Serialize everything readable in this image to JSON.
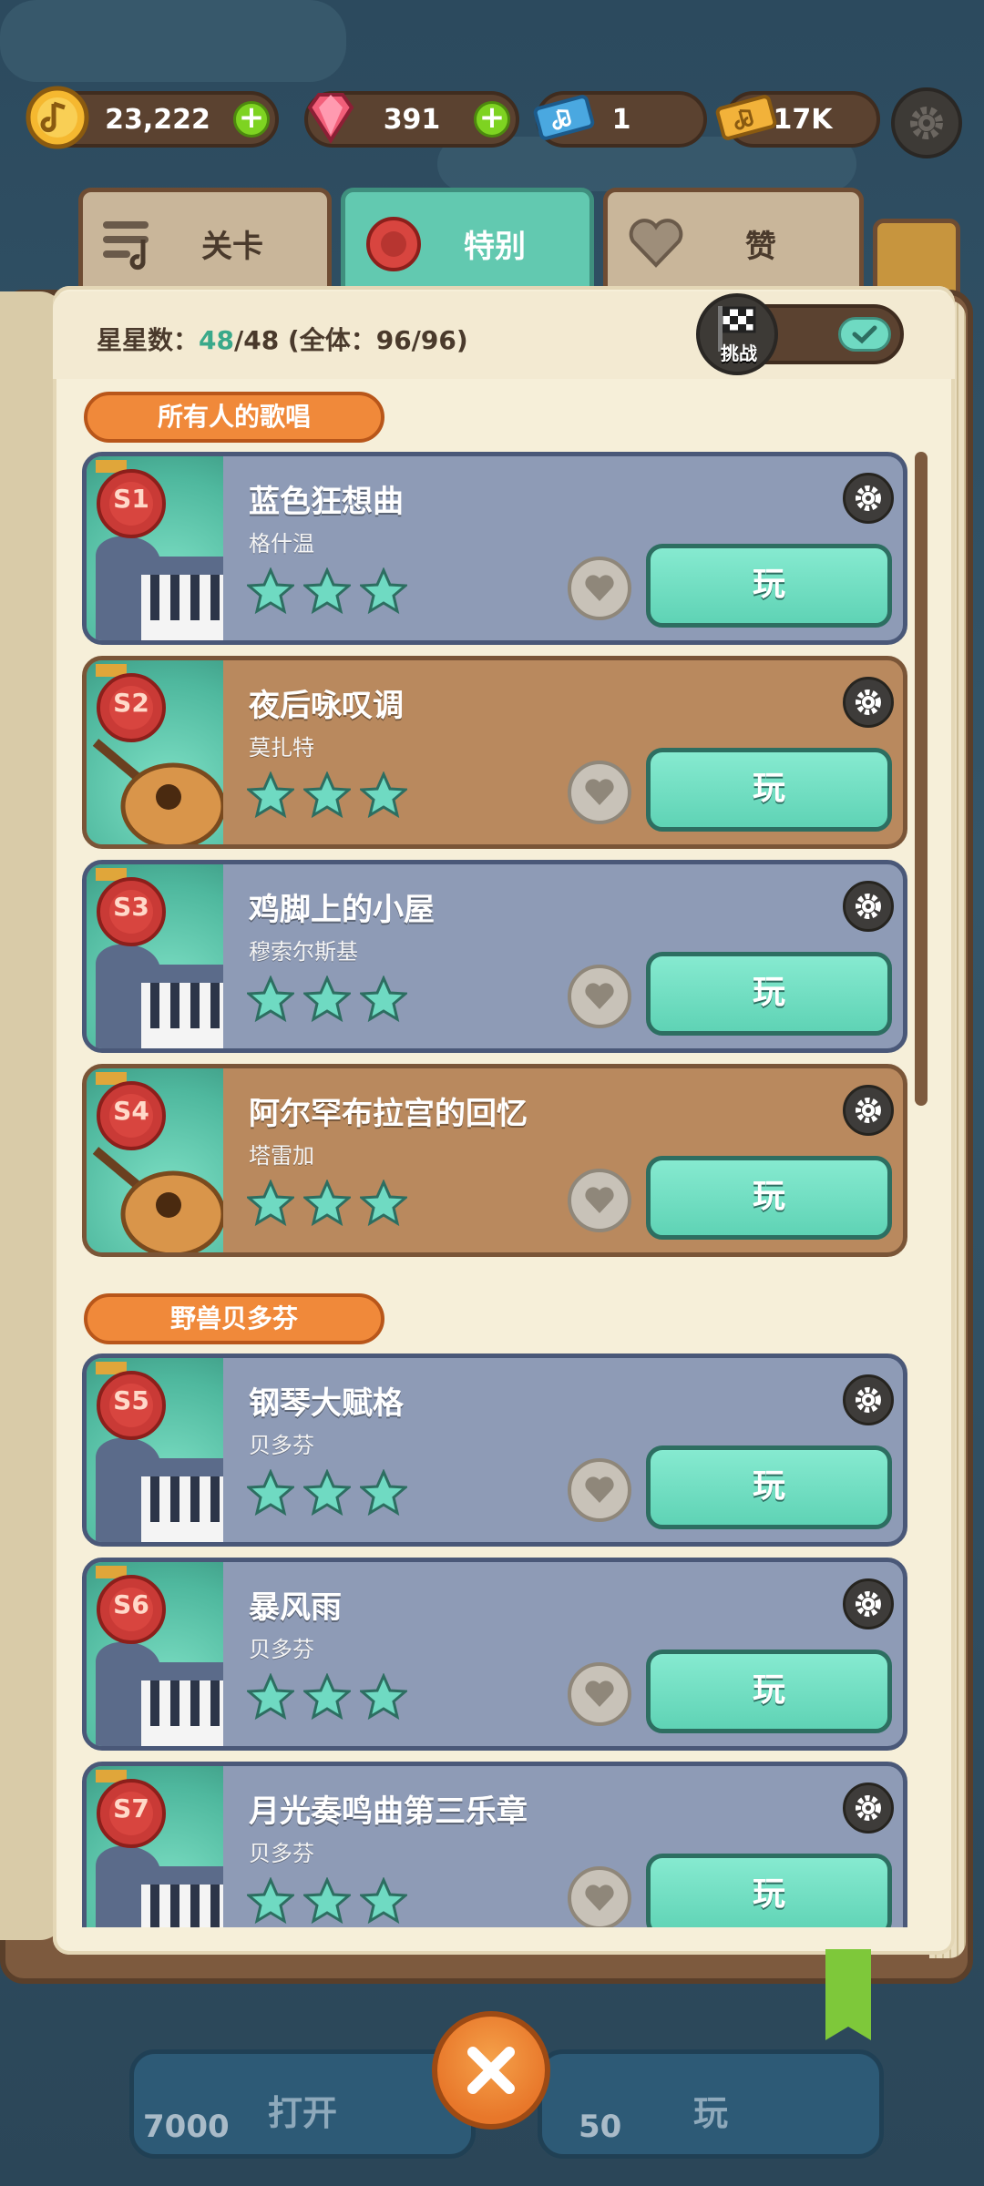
{
  "currencies": {
    "coins": "23,222",
    "gems": "391",
    "tickets": "1",
    "gold_tickets": "17K"
  },
  "tabs": [
    {
      "label": "关卡",
      "active": false
    },
    {
      "label": "特别",
      "active": true
    },
    {
      "label": "赞",
      "active": false
    }
  ],
  "header": {
    "stars_prefix": "星星数：",
    "stars_have": "48",
    "stars_rest": "/48 (全体：96/96)",
    "challenge_label": "挑战",
    "challenge_on": true
  },
  "sections": [
    {
      "title": "所有人的歌唱",
      "songs": [
        {
          "seal": "S1",
          "title": "蓝色狂想曲",
          "composer": "格什温",
          "instrument": "piano",
          "stars": 3,
          "play": "玩"
        },
        {
          "seal": "S2",
          "title": "夜后咏叹调",
          "composer": "莫扎特",
          "instrument": "guitar",
          "stars": 3,
          "play": "玩"
        },
        {
          "seal": "S3",
          "title": "鸡脚上的小屋",
          "composer": "穆索尔斯基",
          "instrument": "piano",
          "stars": 3,
          "play": "玩"
        },
        {
          "seal": "S4",
          "title": "阿尔罕布拉宫的回忆",
          "composer": "塔雷加",
          "instrument": "guitar",
          "stars": 3,
          "play": "玩"
        }
      ]
    },
    {
      "title": "野兽贝多芬",
      "songs": [
        {
          "seal": "S5",
          "title": "钢琴大赋格",
          "composer": "贝多芬",
          "instrument": "piano",
          "stars": 3,
          "play": "玩"
        },
        {
          "seal": "S6",
          "title": "暴风雨",
          "composer": "贝多芬",
          "instrument": "piano",
          "stars": 3,
          "play": "玩"
        },
        {
          "seal": "S7",
          "title": "月光奏鸣曲第三乐章",
          "composer": "贝多芬",
          "instrument": "piano",
          "stars": 3,
          "play": "玩"
        }
      ]
    }
  ],
  "bottom": {
    "open_cost": "7000",
    "open_label": "打开",
    "play_cost": "50",
    "play_label": "玩"
  },
  "colors": {
    "accent_teal": "#62c9b0",
    "orange": "#f0893a",
    "wood": "#7d5a3e"
  }
}
